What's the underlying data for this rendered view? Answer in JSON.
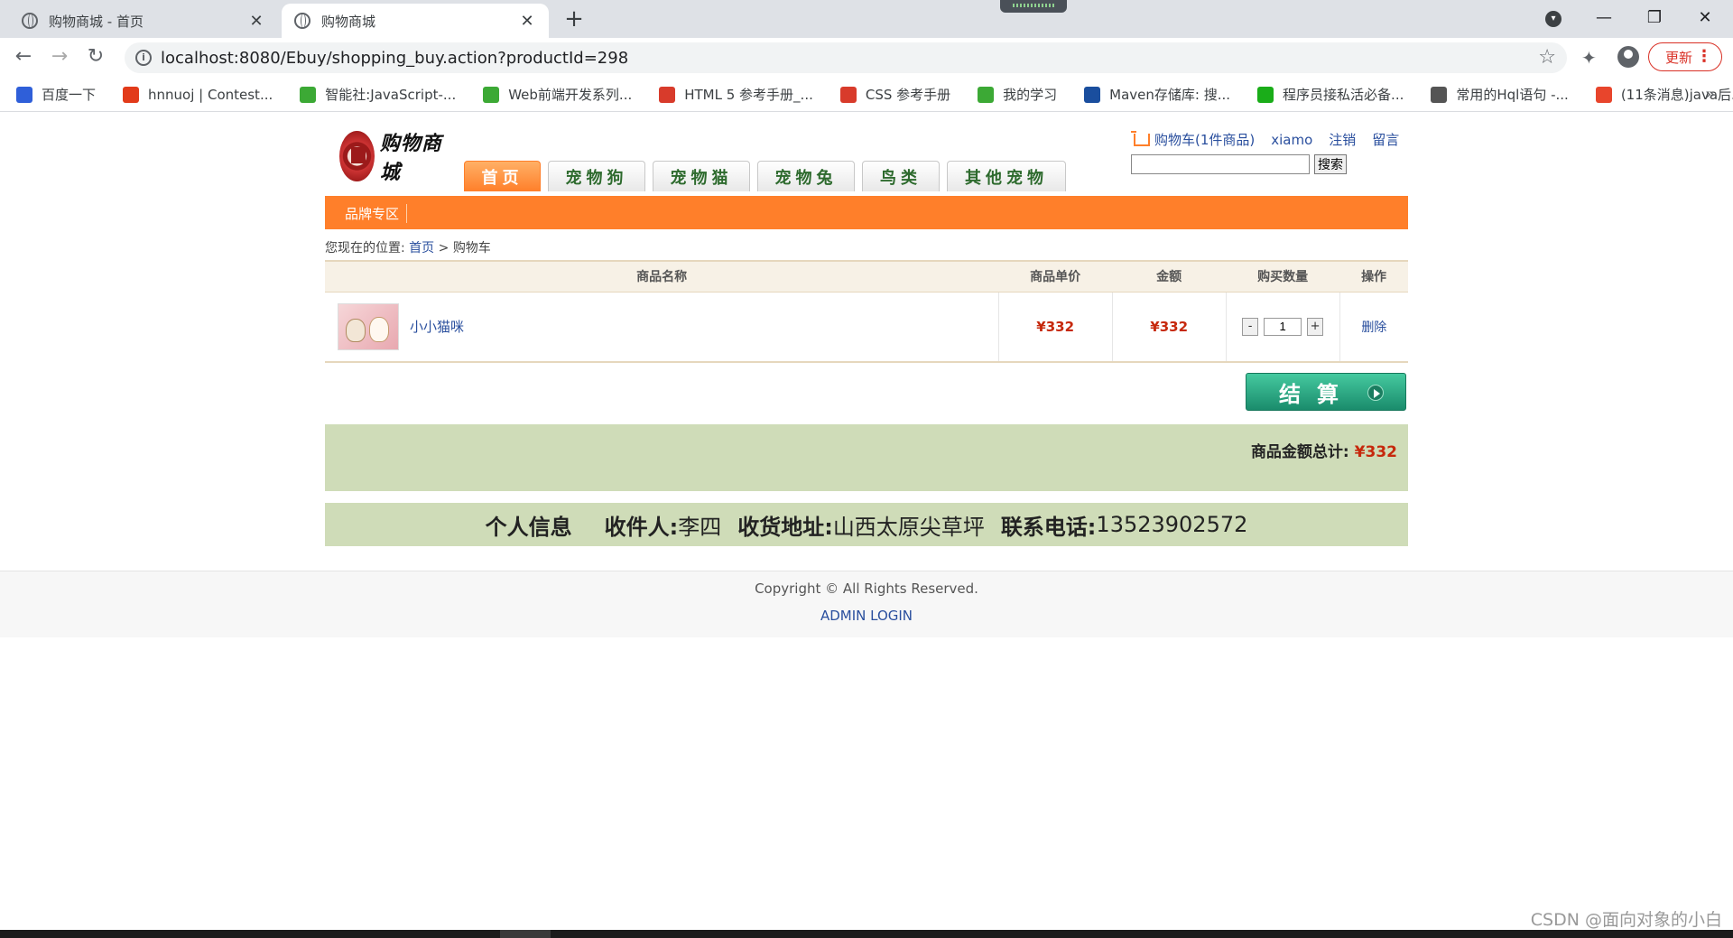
{
  "browser": {
    "tabs": [
      {
        "title": "购物商城 - 首页",
        "active": false
      },
      {
        "title": "购物商城",
        "active": true
      }
    ],
    "new_tab": "+",
    "url": "localhost:8080/Ebuy/shopping_buy.action?productId=298",
    "update_label": "更新",
    "bookmarks": [
      {
        "label": "百度一下",
        "color": "#2f5fd9"
      },
      {
        "label": "hnnuoj | Contest...",
        "color": "#e23b1a"
      },
      {
        "label": "智能社:JavaScript-...",
        "color": "#3ca935"
      },
      {
        "label": "Web前端开发系列...",
        "color": "#3ca935"
      },
      {
        "label": "HTML 5 参考手册_...",
        "color": "#d83b2b"
      },
      {
        "label": "CSS 参考手册",
        "color": "#d83b2b"
      },
      {
        "label": "我的学习",
        "color": "#3ca935"
      },
      {
        "label": "Maven存储库: 搜...",
        "color": "#1a4e9e"
      },
      {
        "label": "程序员接私活必备...",
        "color": "#1aad19"
      },
      {
        "label": "常用的Hql语句 -...",
        "color": "#555555"
      },
      {
        "label": "(11条消息)java后...",
        "color": "#e8452c"
      }
    ],
    "bookmarks_more": "»"
  },
  "site": {
    "logo_text": "购物商城",
    "nav": [
      {
        "label": "首页",
        "active": true
      },
      {
        "label": "宠物狗",
        "active": false
      },
      {
        "label": "宠物猫",
        "active": false
      },
      {
        "label": "宠物兔",
        "active": false
      },
      {
        "label": "鸟类",
        "active": false
      },
      {
        "label": "其他宠物",
        "active": false
      }
    ],
    "cart_link": "购物车(1件商品)",
    "username": "xiamo",
    "logout": "注销",
    "message": "留言",
    "search_button": "搜索",
    "brand_zone": "品牌专区"
  },
  "breadcrumb": {
    "prefix": "您现在的位置:",
    "home": "首页",
    "separator": ">",
    "current": "购物车"
  },
  "cart": {
    "headers": [
      "商品名称",
      "商品单价",
      "金额",
      "购买数量",
      "操作"
    ],
    "items": [
      {
        "name": "小小猫咪",
        "unit_price": "¥332",
        "amount": "¥332",
        "quantity": "1",
        "action": "删除"
      }
    ],
    "minus": "-",
    "plus": "+",
    "checkout_label": "结算",
    "total_label": "商品金额总计:",
    "total_value": "¥332"
  },
  "personal": {
    "title": "个人信息",
    "receiver_label": "收件人:",
    "receiver": "李四",
    "address_label": "收货地址:",
    "address": "山西太原尖草坪",
    "phone_label": "联系电话:",
    "phone": "13523902572"
  },
  "footer": {
    "copyright": "Copyright © All Rights Reserved.",
    "admin_login": "ADMIN LOGIN"
  },
  "watermark": "CSDN @面向对象的小白"
}
